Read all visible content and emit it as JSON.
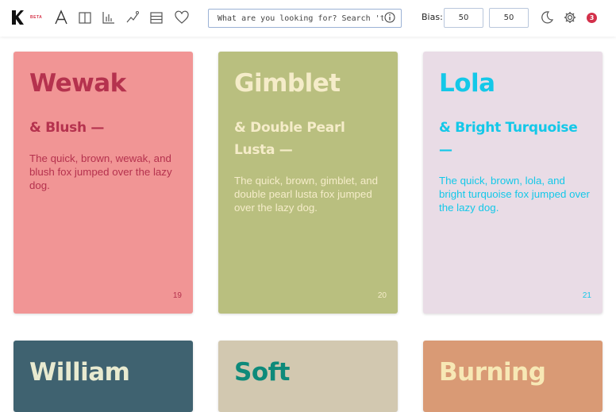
{
  "header": {
    "logo_badge": "BETA",
    "search_placeholder": "What are you looking for? Search 'tips'",
    "bias_label": "Bias:",
    "bias_left": "50",
    "bias_right": "50",
    "notification_count": "3"
  },
  "cards": [
    {
      "title": "Wewak",
      "subtitle": "& Blush —",
      "body": "The quick, brown, wewak, and blush fox jumped over the lazy dog.",
      "number": "19",
      "bg": "#f19595",
      "fg": "#b5324e"
    },
    {
      "title": "Gimblet",
      "subtitle": "& Double Pearl Lusta —",
      "body": "The quick, brown, gimblet, and double pearl lusta fox jumped over the lazy dog.",
      "number": "20",
      "bg": "#b9bf7f",
      "fg": "#f5ecc9"
    },
    {
      "title": "Lola",
      "subtitle": "& Bright Turquoise —",
      "body": "The quick, brown, lola, and bright turquoise fox jumped over the lazy dog.",
      "number": "21",
      "bg": "#e9dce6",
      "fg": "#14c8e8"
    },
    {
      "title": "William",
      "bg": "#3f6270",
      "fg": "#e8ead0"
    },
    {
      "title": "Soft",
      "bg": "#d2c8b0",
      "fg": "#0e8a7a"
    },
    {
      "title": "Burning",
      "bg": "#d99a75",
      "fg": "#f7e8b5"
    }
  ]
}
